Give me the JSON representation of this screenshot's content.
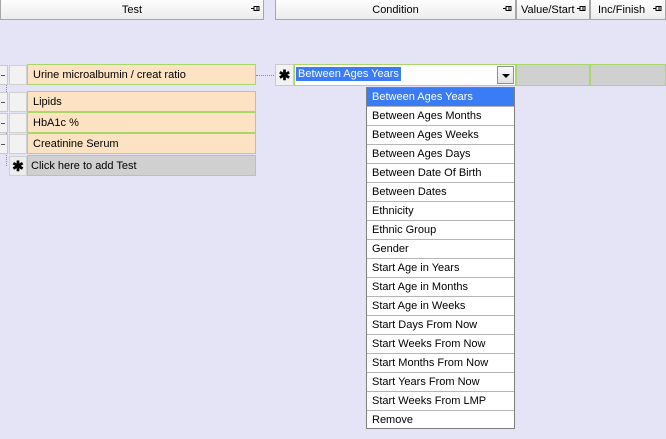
{
  "columns": {
    "test": "Test",
    "condition": "Condition",
    "value_start": "Value/Start",
    "inc_finish": "Inc/Finish"
  },
  "tests": [
    {
      "label": "Urine microalbumin / creat ratio"
    },
    {
      "label": "Lipids"
    },
    {
      "label": "HbA1c %"
    },
    {
      "label": "Creatinine Serum"
    }
  ],
  "add_row_label": "Click here to add Test",
  "condition": {
    "new_row_glyph": "✱",
    "selected": "Between Ages Years",
    "options": [
      "Between Ages Years",
      "Between Ages Months",
      "Between Ages Weeks",
      "Between Ages Days",
      "Between Date Of Birth",
      "Between Dates",
      "Ethnicity",
      "Ethnic Group",
      "Gender",
      "Start Age in Years",
      "Start Age in Months",
      "Start Age in Weeks",
      "Start Days From Now",
      "Start Weeks From Now",
      "Start Months From Now",
      "Start Years From Now",
      "Start Weeks From LMP",
      "Remove"
    ]
  },
  "colors": {
    "background": "#E4E4F6",
    "test_cell": "#FDE2C4",
    "cell_border": "#A8D86A",
    "selection": "#3A7BF6"
  }
}
